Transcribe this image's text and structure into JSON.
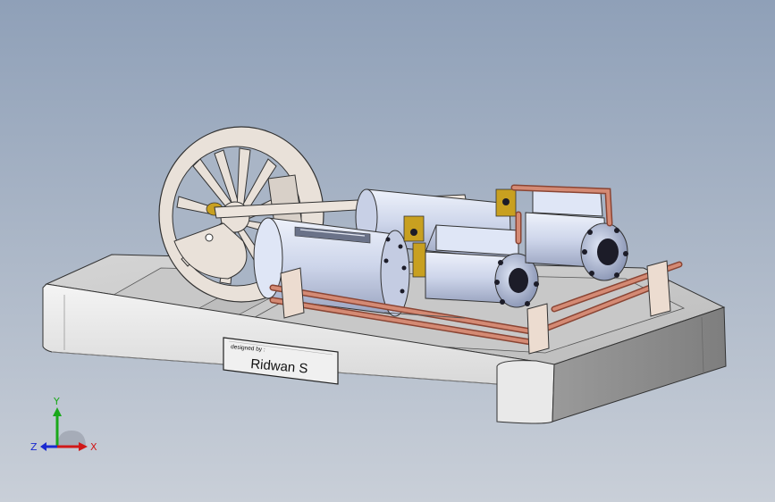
{
  "viewport": {
    "background_top": "#8fa0b8",
    "background_bottom": "#c9cfd8"
  },
  "nameplate": {
    "caption": "designed by :",
    "name": "Ridwan S"
  },
  "model": {
    "base_color": "#e6e6e6",
    "cylinder_color": "#d8e0f4",
    "wheel_color": "#e9e1d9",
    "pipe_color": "#c0715a",
    "brass_color": "#c8a020",
    "bolt_color": "#1c1c28"
  },
  "triad": {
    "x_label": "X",
    "y_label": "Y",
    "z_label": "Z",
    "x_color": "#d01818",
    "y_color": "#1aa81a",
    "z_color": "#1a2ad0"
  }
}
